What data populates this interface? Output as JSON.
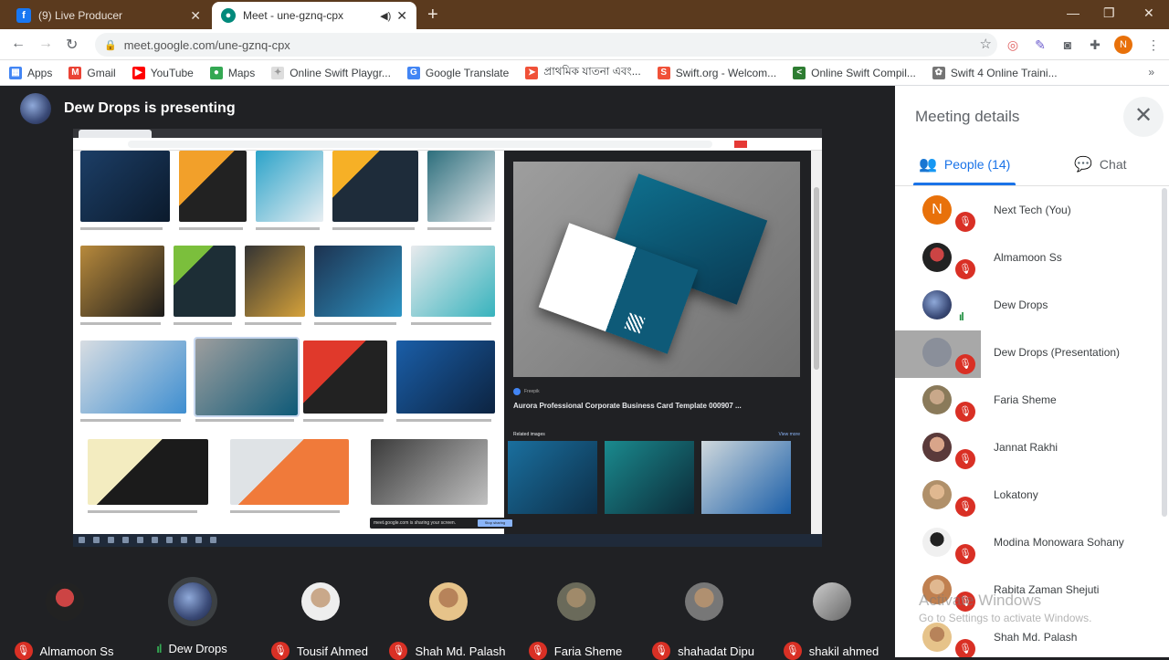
{
  "browser": {
    "tabs": [
      {
        "title": "(9) Live Producer",
        "favicon": "facebook-icon",
        "active": false
      },
      {
        "title": "Meet - une-gznq-cpx",
        "favicon": "google-meet-icon",
        "active": true
      }
    ],
    "url": "meet.google.com/une-gznq-cpx",
    "profile_initial": "N",
    "bookmarks": [
      {
        "label": "Apps",
        "icon": "apps-grid-icon"
      },
      {
        "label": "Gmail",
        "icon": "gmail-icon"
      },
      {
        "label": "YouTube",
        "icon": "youtube-icon"
      },
      {
        "label": "Maps",
        "icon": "maps-icon"
      },
      {
        "label": "Online Swift Playgr...",
        "icon": "swift-playground-icon"
      },
      {
        "label": "Google Translate",
        "icon": "translate-icon"
      },
      {
        "label": "প্রাথমিক যাতনা এবং...",
        "icon": "swift-icon"
      },
      {
        "label": "Swift.org - Welcom...",
        "icon": "swift-org-icon"
      },
      {
        "label": "Online Swift Compil...",
        "icon": "compiler-icon"
      },
      {
        "label": "Swift 4 Online Traini...",
        "icon": "training-icon"
      }
    ]
  },
  "meet": {
    "presenter_label": "Dew Drops is presenting",
    "shared_screen": {
      "product_title": "Aurora Professional Corporate Business Card Template 000907 ...",
      "source": "Freepik",
      "related_label": "Related images",
      "view_more": "View more",
      "sharing_notice": "meet.google.com is sharing your screen.",
      "stop_sharing": "Stop sharing"
    },
    "filmstrip": [
      {
        "name": "Almamoon Ss",
        "status": "muted"
      },
      {
        "name": "Dew Drops",
        "status": "speaking"
      },
      {
        "name": "Tousif Ahmed",
        "status": "muted"
      },
      {
        "name": "Shah Md. Palash",
        "status": "muted"
      },
      {
        "name": "Faria Sheme",
        "status": "muted"
      },
      {
        "name": "shahadat Dipu",
        "status": "muted"
      },
      {
        "name": "shakil ahmed",
        "status": "muted"
      }
    ]
  },
  "panel": {
    "title": "Meeting details",
    "tab_people": "People (14)",
    "tab_chat": "Chat",
    "people": [
      {
        "name": "Next Tech (You)",
        "initial": "N",
        "color": "#e8710a",
        "status": "muted"
      },
      {
        "name": "Almamoon Ss",
        "initial": "",
        "color": "#6b2a2a",
        "status": "muted"
      },
      {
        "name": "Dew Drops",
        "initial": "",
        "color": "#3b4b78",
        "status": "speaking"
      },
      {
        "name": "Dew Drops (Presentation)",
        "initial": "",
        "color": "#7a7f8c",
        "status": "muted"
      },
      {
        "name": "Faria Sheme",
        "initial": "",
        "color": "#8a7a5a",
        "status": "muted"
      },
      {
        "name": "Jannat Rakhi",
        "initial": "",
        "color": "#5a3a3a",
        "status": "muted"
      },
      {
        "name": "Lokatony",
        "initial": "",
        "color": "#b0906a",
        "status": "muted"
      },
      {
        "name": "Modina Monowara Sohany",
        "initial": "",
        "color": "#e0e0e0",
        "status": "muted"
      },
      {
        "name": "Rabita Zaman Shejuti",
        "initial": "",
        "color": "#c08050",
        "status": "muted"
      },
      {
        "name": "Shah Md. Palash",
        "initial": "",
        "color": "#c0a070",
        "status": "muted"
      }
    ]
  },
  "os": {
    "watermark_title": "Activate Windows",
    "watermark_sub": "Go to Settings to activate Windows."
  }
}
